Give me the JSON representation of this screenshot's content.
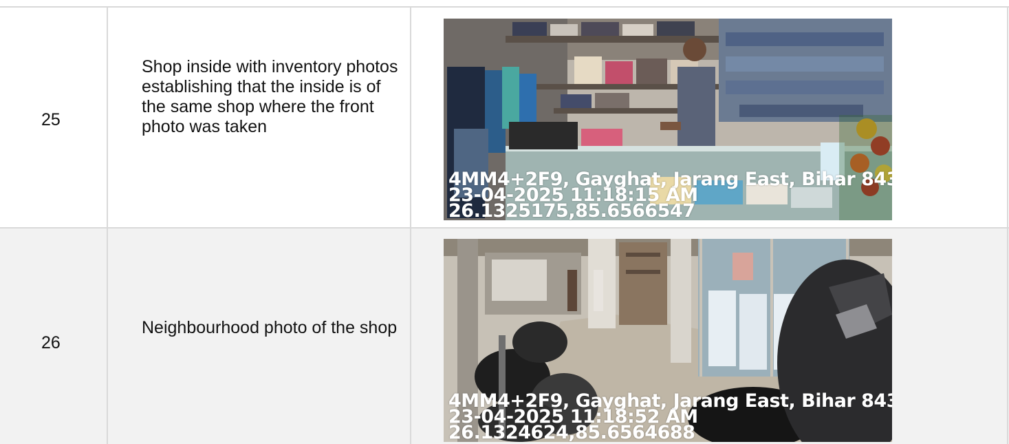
{
  "rows": [
    {
      "number": "25",
      "description": "Shop inside with inventory photos establishing that the inside is of the same shop where the front photo was taken",
      "photo": {
        "depicts": "shop-interior-photo",
        "stamp_address": "4MM4+2F9, Gayghat, Jarang East, Bihar 843",
        "stamp_datetime": "23-04-2025 11:18:15 AM",
        "stamp_coords": "26.1325175,85.6566547"
      }
    },
    {
      "number": "26",
      "description": "Neighbourhood photo of the shop",
      "photo": {
        "depicts": "neighbourhood-photo",
        "stamp_address": "4MM4+2F9, Gayghat, Jarang East, Bihar 843",
        "stamp_datetime": "23-04-2025 11:18:52 AM",
        "stamp_coords": "26.1324624,85.6564688"
      }
    }
  ]
}
